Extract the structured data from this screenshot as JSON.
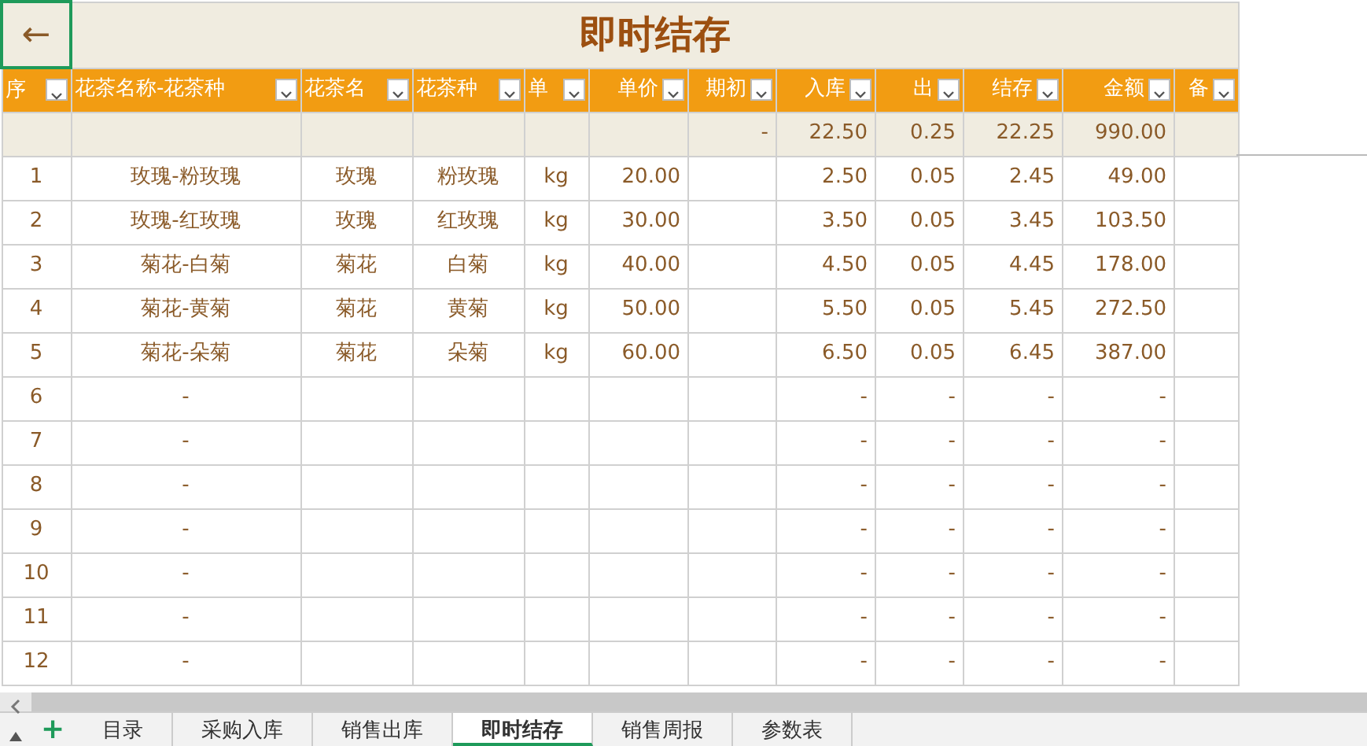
{
  "title": "即时结存",
  "back_button": "←",
  "columns": [
    "序",
    "花茶名称-花茶种",
    "花茶名",
    "花茶种",
    "单",
    "单价",
    "期初",
    "入库",
    "出",
    "结存",
    "金额",
    "备"
  ],
  "totals": {
    "opening": "-",
    "stock_in": "22.50",
    "stock_out": "0.25",
    "balance": "22.25",
    "amount": "990.00"
  },
  "rows": [
    {
      "no": "1",
      "full_name": "玫瑰-粉玫瑰",
      "name": "玫瑰",
      "variety": "粉玫瑰",
      "unit": "kg",
      "price": "20.00",
      "stock_in": "2.50",
      "stock_out": "0.05",
      "balance": "2.45",
      "amount": "49.00"
    },
    {
      "no": "2",
      "full_name": "玫瑰-红玫瑰",
      "name": "玫瑰",
      "variety": "红玫瑰",
      "unit": "kg",
      "price": "30.00",
      "stock_in": "3.50",
      "stock_out": "0.05",
      "balance": "3.45",
      "amount": "103.50"
    },
    {
      "no": "3",
      "full_name": "菊花-白菊",
      "name": "菊花",
      "variety": "白菊",
      "unit": "kg",
      "price": "40.00",
      "stock_in": "4.50",
      "stock_out": "0.05",
      "balance": "4.45",
      "amount": "178.00"
    },
    {
      "no": "4",
      "full_name": "菊花-黄菊",
      "name": "菊花",
      "variety": "黄菊",
      "unit": "kg",
      "price": "50.00",
      "stock_in": "5.50",
      "stock_out": "0.05",
      "balance": "5.45",
      "amount": "272.50"
    },
    {
      "no": "5",
      "full_name": "菊花-朵菊",
      "name": "菊花",
      "variety": "朵菊",
      "unit": "kg",
      "price": "60.00",
      "stock_in": "6.50",
      "stock_out": "0.05",
      "balance": "6.45",
      "amount": "387.00"
    },
    {
      "no": "6",
      "full_name": "-",
      "stock_in": "-",
      "stock_out": "-",
      "balance": "-",
      "amount": "-"
    },
    {
      "no": "7",
      "full_name": "-",
      "stock_in": "-",
      "stock_out": "-",
      "balance": "-",
      "amount": "-"
    },
    {
      "no": "8",
      "full_name": "-",
      "stock_in": "-",
      "stock_out": "-",
      "balance": "-",
      "amount": "-"
    },
    {
      "no": "9",
      "full_name": "-",
      "stock_in": "-",
      "stock_out": "-",
      "balance": "-",
      "amount": "-"
    },
    {
      "no": "10",
      "full_name": "-",
      "stock_in": "-",
      "stock_out": "-",
      "balance": "-",
      "amount": "-"
    },
    {
      "no": "11",
      "full_name": "-",
      "stock_in": "-",
      "stock_out": "-",
      "balance": "-",
      "amount": "-"
    },
    {
      "no": "12",
      "full_name": "-",
      "stock_in": "-",
      "stock_out": "-",
      "balance": "-",
      "amount": "-"
    }
  ],
  "add_sheet": "+",
  "sheet_tabs": [
    {
      "label": "目录",
      "selected": false
    },
    {
      "label": "采购入库",
      "selected": false
    },
    {
      "label": "销售出库",
      "selected": false
    },
    {
      "label": "即时结存",
      "selected": true
    },
    {
      "label": "销售周报",
      "selected": false
    },
    {
      "label": "参数表",
      "selected": false
    }
  ]
}
